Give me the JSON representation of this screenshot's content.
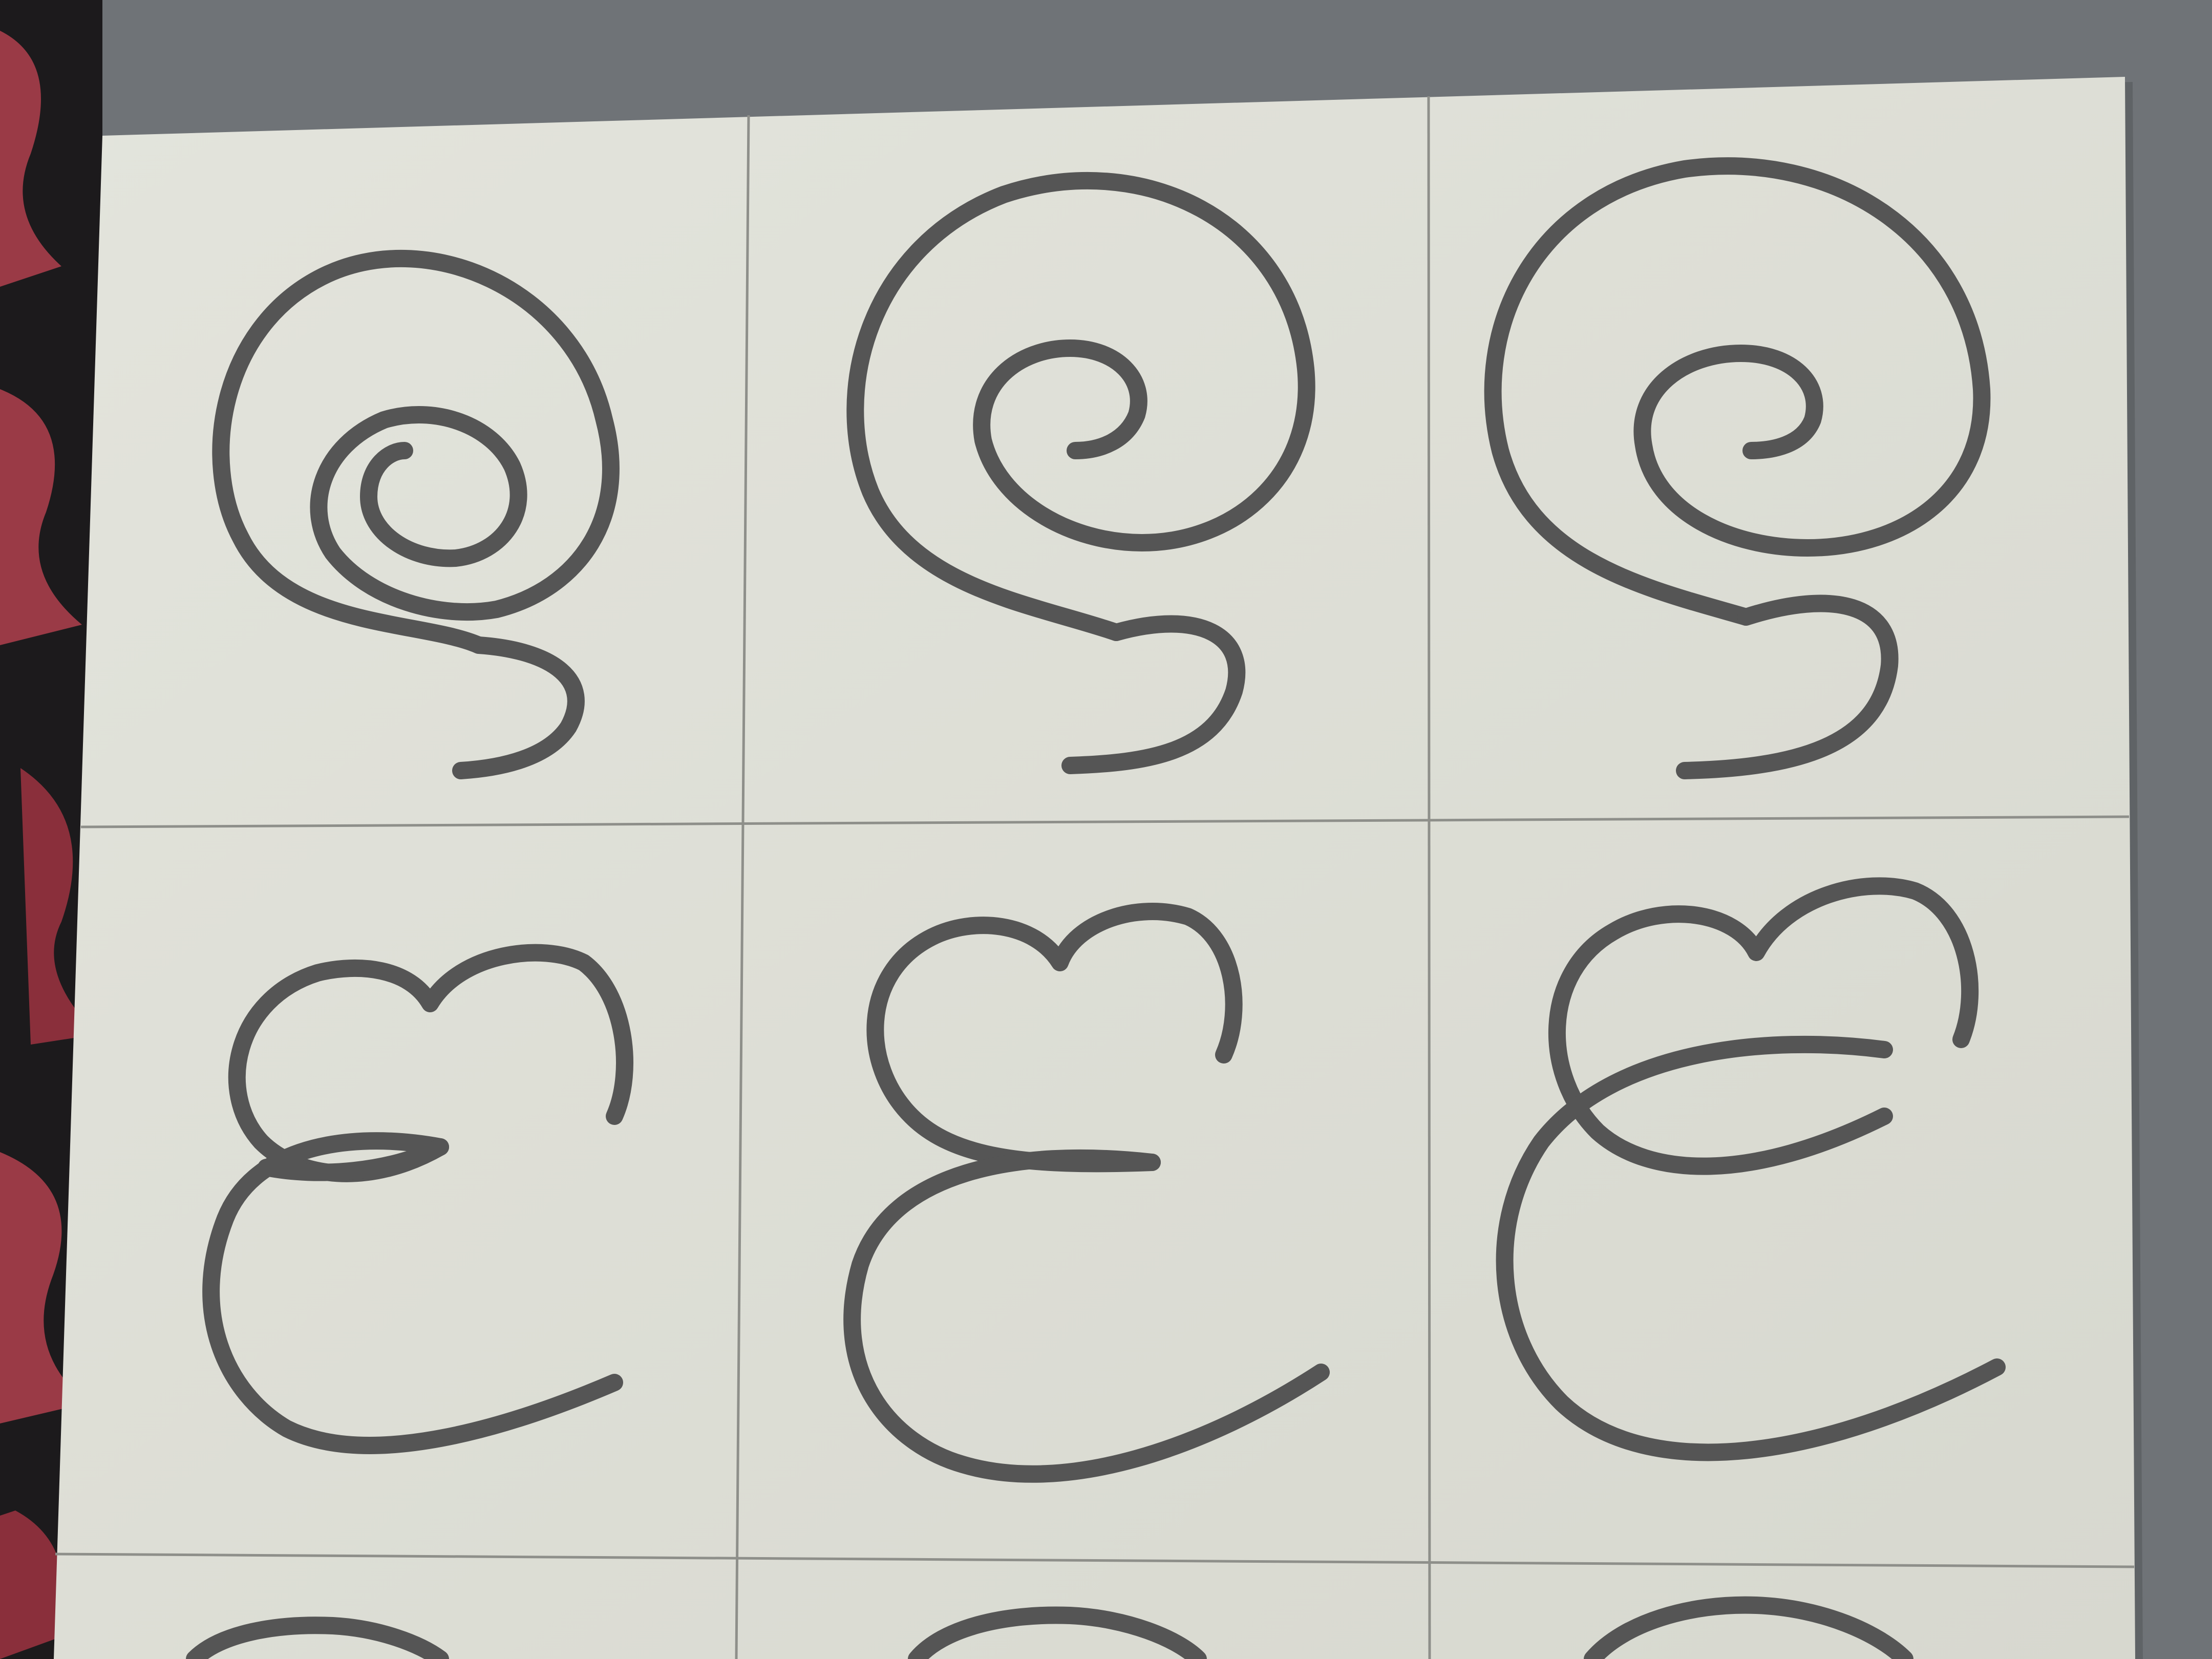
{
  "scene": {
    "description_hidden": "",
    "colors": {
      "background_surface": "#6f7377",
      "fabric_dark": "#1c1a1c",
      "fabric_red": "#9a3a46",
      "paper": "#dfe0d8",
      "paper_shadow": "#c9cac2",
      "grid_line": "#8e8f8a",
      "ink": "#555555"
    },
    "grid": {
      "columns": 3,
      "rows_visible": 3
    },
    "cells": [
      {
        "glyph": "spiral-with-tail-icon"
      },
      {
        "glyph": "spiral-with-tail-icon"
      },
      {
        "glyph": "spiral-with-tail-icon"
      },
      {
        "glyph": "looped-c-glyph-icon"
      },
      {
        "glyph": "looped-c-glyph-icon"
      },
      {
        "glyph": "looped-c-glyph-icon"
      },
      {
        "glyph": "partial-glyph-icon"
      },
      {
        "glyph": "partial-glyph-icon"
      },
      {
        "glyph": "partial-glyph-icon"
      }
    ]
  }
}
